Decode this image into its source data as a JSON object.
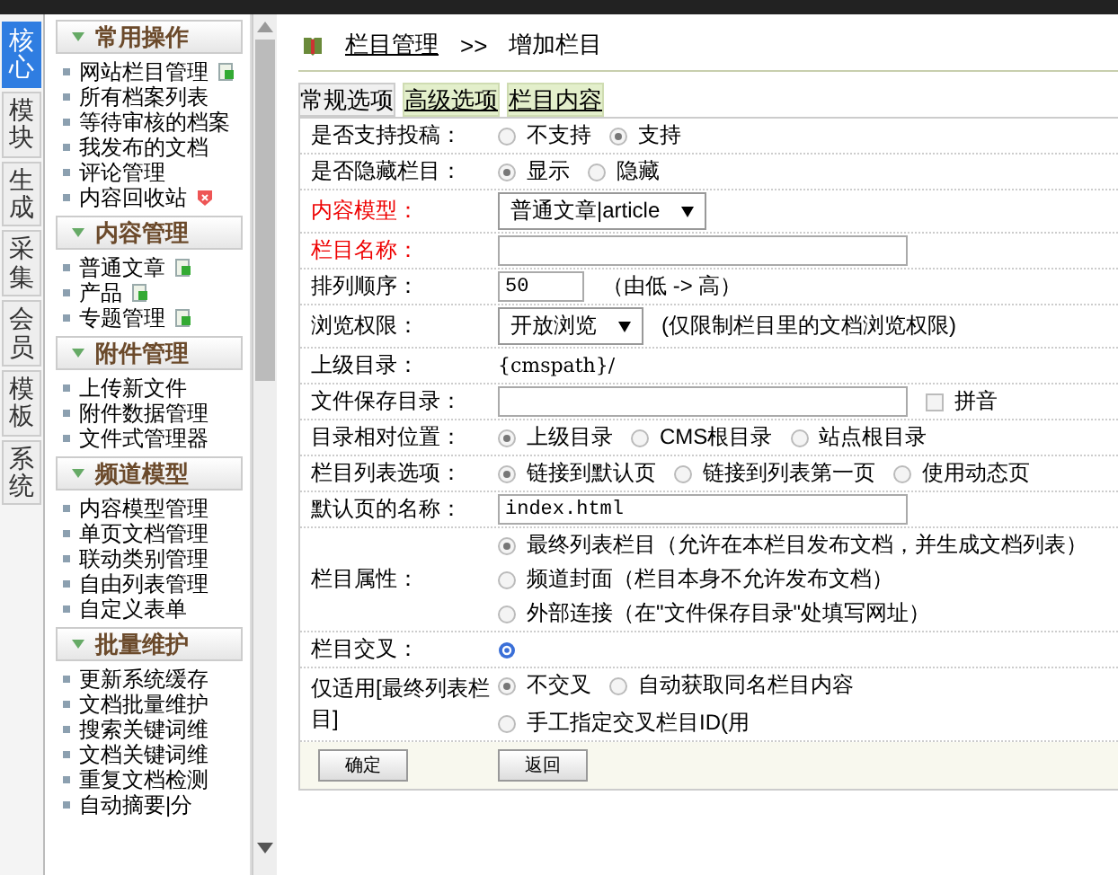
{
  "sidebar": {
    "tabs": [
      {
        "label": "核心",
        "selected": true
      },
      {
        "label": "模块",
        "selected": false
      },
      {
        "label": "生成",
        "selected": false
      },
      {
        "label": "采集",
        "selected": false
      },
      {
        "label": "会员",
        "selected": false
      },
      {
        "label": "模板",
        "selected": false
      },
      {
        "label": "系统",
        "selected": false
      }
    ],
    "sections": [
      {
        "title": "常用操作",
        "items": [
          {
            "label": "网站栏目管理",
            "kind": "add"
          },
          {
            "label": "所有档案列表"
          },
          {
            "label": "等待审核的档案"
          },
          {
            "label": "我发布的文档"
          },
          {
            "label": "评论管理"
          },
          {
            "label": "内容回收站",
            "kind": "delete"
          }
        ]
      },
      {
        "title": "内容管理",
        "items": [
          {
            "label": "普通文章",
            "kind": "add"
          },
          {
            "label": "产品",
            "kind": "add"
          },
          {
            "label": "专题管理",
            "kind": "add"
          }
        ]
      },
      {
        "title": "附件管理",
        "items": [
          {
            "label": "上传新文件"
          },
          {
            "label": "附件数据管理"
          },
          {
            "label": "文件式管理器"
          }
        ]
      },
      {
        "title": "频道模型",
        "items": [
          {
            "label": "内容模型管理"
          },
          {
            "label": "单页文档管理"
          },
          {
            "label": "联动类别管理"
          },
          {
            "label": "自由列表管理"
          },
          {
            "label": "自定义表单"
          }
        ]
      },
      {
        "title": "批量维护",
        "items": [
          {
            "label": "更新系统缓存"
          },
          {
            "label": "文档批量维护"
          },
          {
            "label": "搜索关键词维"
          },
          {
            "label": "文档关键词维"
          },
          {
            "label": "重复文档检测"
          },
          {
            "label": "自动摘要|分"
          }
        ]
      }
    ]
  },
  "main": {
    "breadcrumb": {
      "link": "栏目管理",
      "separator": ">>",
      "current": "增加栏目"
    },
    "tabs": [
      {
        "label": "常规选项",
        "selected": true
      },
      {
        "label": "高级选项",
        "selected": false
      },
      {
        "label": "栏目内容",
        "selected": false
      }
    ],
    "rows": [
      {
        "label": "是否支持投稿：",
        "required": false,
        "kind": "radio",
        "options": [
          {
            "label": "不支持",
            "selected": false
          },
          {
            "label": "支持",
            "selected": true
          }
        ]
      },
      {
        "label": "是否隐藏栏目：",
        "required": false,
        "kind": "radio",
        "options": [
          {
            "label": "显示",
            "selected": true
          },
          {
            "label": "隐藏",
            "selected": false
          }
        ]
      },
      {
        "label": "内容模型：",
        "required": true,
        "kind": "select",
        "value": "普通文章|article"
      },
      {
        "label": "栏目名称：",
        "required": true,
        "kind": "input"
      },
      {
        "label": "排列顺序：",
        "required": false,
        "kind": "short_input",
        "value": "50",
        "note": "（由低 -> 高）"
      },
      {
        "label": "浏览权限：",
        "required": false,
        "kind": "select",
        "value": "开放浏览",
        "note": "(仅限制栏目里的文档浏览权限)"
      },
      {
        "label": "上级目录：",
        "required": false,
        "kind": "text",
        "value": "{cmspath}/"
      },
      {
        "label": "文件保存目录：",
        "required": false,
        "kind": "input_check",
        "check_label": "拼音",
        "checked": false
      },
      {
        "label": "目录相对位置：",
        "required": false,
        "kind": "radio",
        "options": [
          {
            "label": "上级目录",
            "selected": true
          },
          {
            "label": "CMS根目录",
            "selected": false
          },
          {
            "label": "站点根目录",
            "selected": false
          }
        ]
      },
      {
        "label": "栏目列表选项：",
        "required": false,
        "kind": "radio",
        "options": [
          {
            "label": "链接到默认页",
            "selected": true
          },
          {
            "label": "链接到列表第一页",
            "selected": false
          },
          {
            "label": "使用动态页",
            "selected": false
          }
        ]
      },
      {
        "label": "默认页的名称：",
        "required": false,
        "kind": "input",
        "value": "index.html"
      },
      {
        "label": "栏目属性：",
        "required": false,
        "kind": "radio_stack",
        "options": [
          {
            "label": "最终列表栏目（允许在本栏目发布文档，并生成文档列表）",
            "selected": true
          },
          {
            "label": "频道封面（栏目本身不允许发布文档）",
            "selected": false
          },
          {
            "label": "外部连接（在\"文件保存目录\"处填写网址）",
            "selected": false
          }
        ]
      },
      {
        "label": "栏目交叉：",
        "required": false,
        "kind": "help"
      },
      {
        "label": "仅适用[最终列表栏目]",
        "required": false,
        "kind": "radio",
        "options": [
          {
            "label": "不交叉",
            "selected": true
          },
          {
            "label": "自动获取同名栏目内容",
            "selected": false
          },
          {
            "label": "手工指定交叉栏目ID(用",
            "selected": false
          }
        ]
      }
    ],
    "buttons": [
      "确定",
      "返回"
    ]
  }
}
